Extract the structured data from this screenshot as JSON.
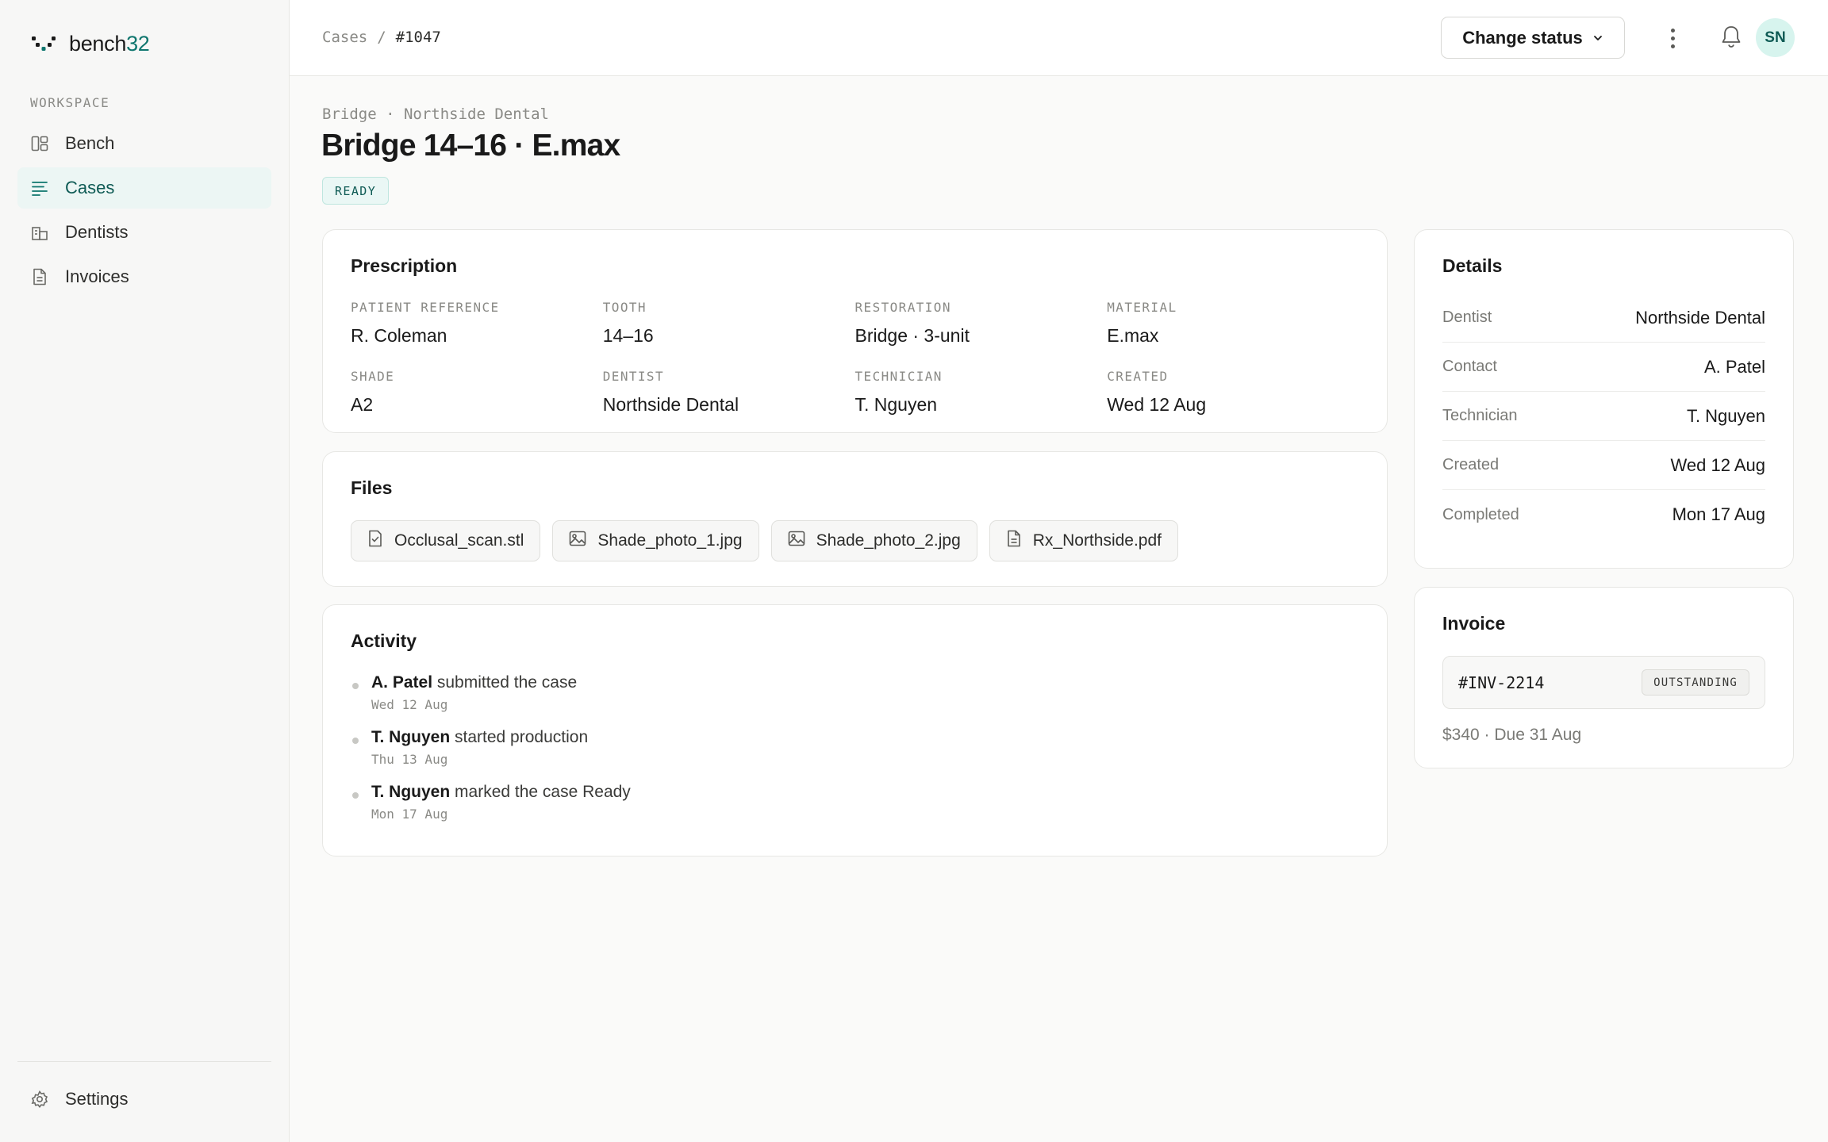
{
  "app": {
    "name_prefix": "bench",
    "name_suffix": "32"
  },
  "sidebar": {
    "section_label": "WORKSPACE",
    "items": [
      {
        "label": "Bench",
        "icon": "board-icon"
      },
      {
        "label": "Cases",
        "icon": "list-icon",
        "active": true
      },
      {
        "label": "Dentists",
        "icon": "building-icon"
      },
      {
        "label": "Invoices",
        "icon": "document-icon"
      }
    ],
    "settings_label": "Settings"
  },
  "topbar": {
    "breadcrumb": {
      "root": "Cases",
      "separator": "/",
      "current": "#1047"
    },
    "change_status_label": "Change status",
    "avatar_initials": "SN"
  },
  "case": {
    "eyebrow": "Bridge · Northside Dental",
    "title": "Bridge 14–16 · E.max",
    "status": "READY"
  },
  "prescription": {
    "title": "Prescription",
    "fields": [
      {
        "label": "PATIENT REFERENCE",
        "value": "R. Coleman"
      },
      {
        "label": "TOOTH",
        "value": "14–16"
      },
      {
        "label": "RESTORATION",
        "value": "Bridge · 3-unit"
      },
      {
        "label": "MATERIAL",
        "value": "E.max"
      },
      {
        "label": "SHADE",
        "value": "A2"
      },
      {
        "label": "DENTIST",
        "value": "Northside Dental"
      },
      {
        "label": "TECHNICIAN",
        "value": "T. Nguyen"
      },
      {
        "label": "CREATED",
        "value": "Wed 12 Aug"
      }
    ]
  },
  "files": {
    "title": "Files",
    "items": [
      {
        "name": "Occlusal_scan.stl",
        "icon": "scan-file-icon"
      },
      {
        "name": "Shade_photo_1.jpg",
        "icon": "image-icon"
      },
      {
        "name": "Shade_photo_2.jpg",
        "icon": "image-icon"
      },
      {
        "name": "Rx_Northside.pdf",
        "icon": "document-icon"
      }
    ]
  },
  "activity": {
    "title": "Activity",
    "items": [
      {
        "actor": "A. Patel",
        "action": " submitted the case",
        "time": "Wed 12 Aug"
      },
      {
        "actor": "T. Nguyen",
        "action": " started production",
        "time": "Thu 13 Aug"
      },
      {
        "actor": "T. Nguyen",
        "action": " marked the case Ready",
        "time": "Mon 17 Aug"
      }
    ]
  },
  "details": {
    "title": "Details",
    "rows": [
      {
        "label": "Dentist",
        "value": "Northside Dental"
      },
      {
        "label": "Contact",
        "value": "A. Patel"
      },
      {
        "label": "Technician",
        "value": "T. Nguyen"
      },
      {
        "label": "Created",
        "value": "Wed 12 Aug"
      },
      {
        "label": "Completed",
        "value": "Mon 17 Aug"
      }
    ]
  },
  "invoice": {
    "title": "Invoice",
    "number": "#INV-2214",
    "status": "OUTSTANDING",
    "meta": "$340 · Due 31 Aug"
  },
  "colors": {
    "accent": "#0f766e",
    "accent_soft": "#ecf6f4",
    "border": "#e7e7e4",
    "background": "#fafaf9"
  }
}
